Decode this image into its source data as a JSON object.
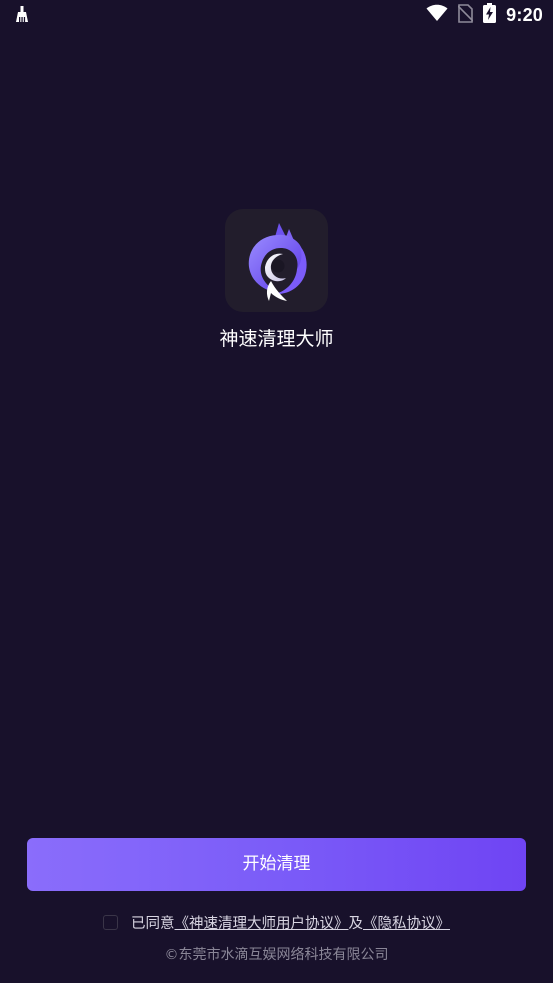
{
  "status_bar": {
    "time": "9:20",
    "icons": [
      "cleaner-broom-icon",
      "wifi-icon",
      "no-sim-icon",
      "battery-charging-icon"
    ]
  },
  "app": {
    "name": "神速清理大师",
    "logo_icon": "fox-swirl-logo-icon"
  },
  "start_button": {
    "label": "开始清理"
  },
  "agreement": {
    "checked": false,
    "prefix": "已同意",
    "user_agreement": "《神速清理大师用户协议》",
    "connector": "及",
    "privacy_policy": "《隐私协议》"
  },
  "footer": {
    "copyright": "©东莞市水滴互娱网络科技有限公司"
  },
  "colors": {
    "background": "#18112b",
    "button_gradient_start": "#8a6dfb",
    "button_gradient_end": "#6f44f3",
    "logo_bg": "#221d2c"
  }
}
